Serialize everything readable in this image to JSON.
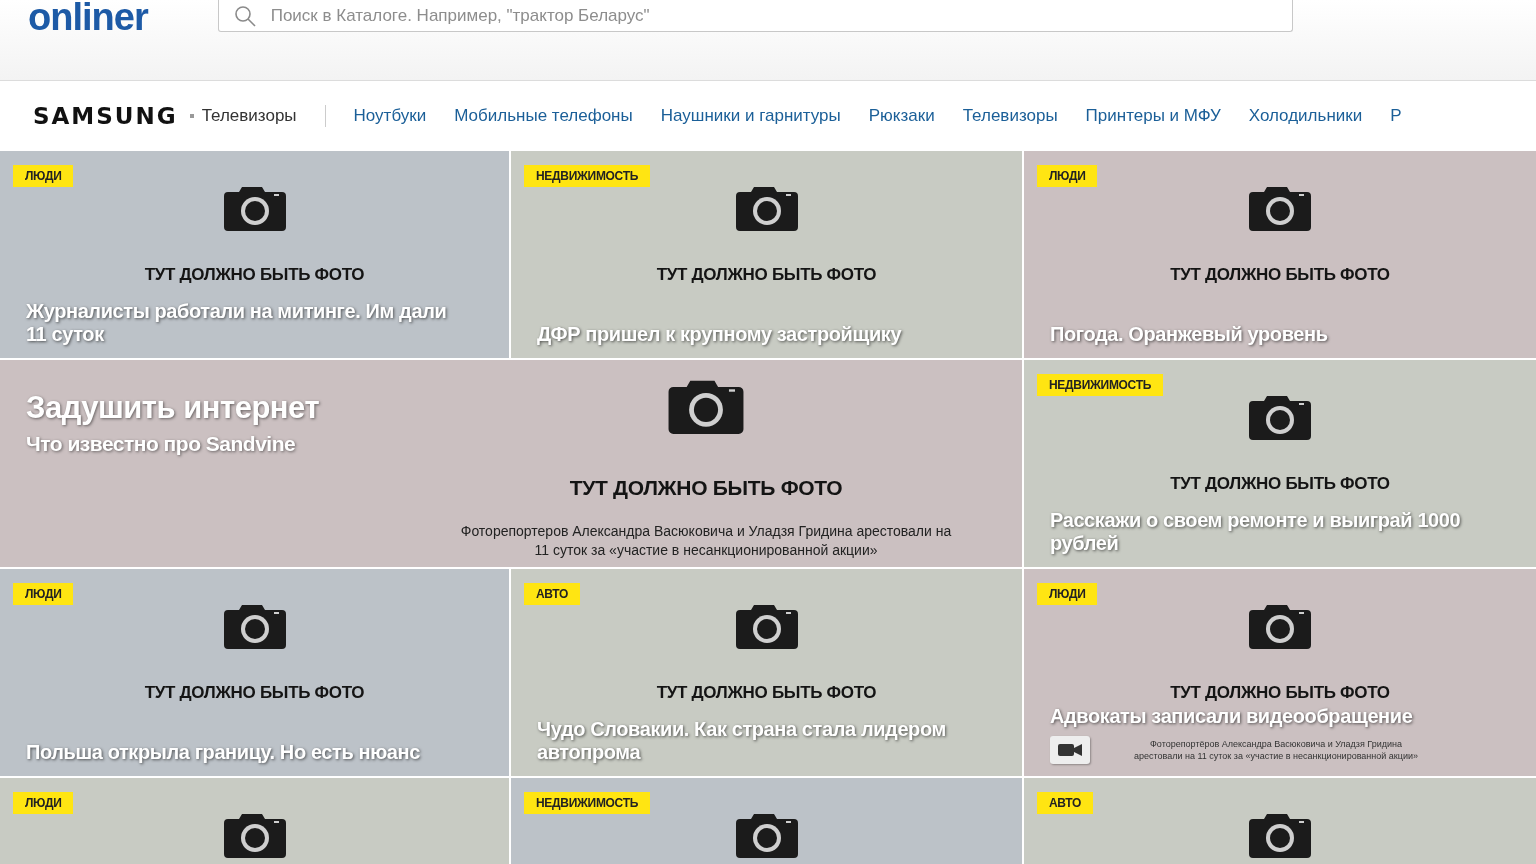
{
  "header": {
    "logo": "onliner",
    "search": {
      "placeholder": "Поиск в Каталоге. Например, \"трактор Беларус\""
    }
  },
  "brand_bar": {
    "brand": "SAMSUNG",
    "current": "Телевизоры",
    "links": [
      "Ноутбуки",
      "Мобильные телефоны",
      "Наушники и гарнитуры",
      "Рюкзаки",
      "Телевизоры",
      "Принтеры и МФУ",
      "Холодильники",
      "Р"
    ]
  },
  "rows": [
    [
      {
        "kind": "card",
        "color": "#bcc2c8",
        "tag": "ЛЮДИ",
        "photo_label": "ТУТ ДОЛЖНО БЫТЬ ФОТО",
        "headline": "Журналисты работали на митинге. Им дали 11 суток"
      },
      {
        "kind": "card",
        "color": "#c8cbc3",
        "tag": "НЕДВИЖИМОСТЬ",
        "photo_label": "ТУТ ДОЛЖНО БЫТЬ ФОТО",
        "headline": "ДФР пришел к крупному застройщику"
      },
      {
        "kind": "card",
        "color": "#cbc0c1",
        "tag": "ЛЮДИ",
        "photo_label": "ТУТ ДОЛЖНО БЫТЬ ФОТО",
        "headline": "Погода. Оранжевый уровень"
      }
    ],
    [
      {
        "kind": "feature",
        "color": "#cbc0c1",
        "title": "Задушить интернет",
        "subtitle": "Что известно про Sandvine",
        "photo_label": "ТУТ ДОЛЖНО БЫТЬ ФОТО",
        "photo_caption": "Фоторепортеров Александра Васюковича и Уладзя Гридина арестовали на 11 суток за «участие в несанкционированной акции»"
      },
      {
        "kind": "card",
        "color": "#c8cbc3",
        "tag": "НЕДВИЖИМОСТЬ",
        "photo_label": "ТУТ ДОЛЖНО БЫТЬ ФОТО",
        "headline": "Расскажи о своем ремонте и выиграй 1000 рублей"
      }
    ],
    [
      {
        "kind": "card",
        "color": "#bcc2c8",
        "tag": "ЛЮДИ",
        "photo_label": "ТУТ ДОЛЖНО БЫТЬ ФОТО",
        "headline": "Польша открыла границу. Но есть нюанс"
      },
      {
        "kind": "card",
        "color": "#c8cbc3",
        "tag": "АВТО",
        "photo_label": "ТУТ ДОЛЖНО БЫТЬ ФОТО",
        "headline": "Чудо Словакии. Как страна стала лидером автопрома"
      },
      {
        "kind": "card",
        "color": "#cbc0c1",
        "tag": "ЛЮДИ",
        "photo_label": "ТУТ ДОЛЖНО БЫТЬ ФОТО",
        "headline": "Адвокаты записали видеообращение",
        "video": true,
        "photo_caption": "Фоторепортёров Александра Васюковича и Уладзя Гридина арестовали на 11 суток за «участие в несанкционированной акции»"
      }
    ],
    [
      {
        "kind": "card",
        "color": "#c8cbc3",
        "tag": "ЛЮДИ"
      },
      {
        "kind": "card",
        "color": "#bcc2c8",
        "tag": "НЕДВИЖИМОСТЬ"
      },
      {
        "kind": "card",
        "color": "#c8cbc3",
        "tag": "АВТО"
      }
    ]
  ]
}
